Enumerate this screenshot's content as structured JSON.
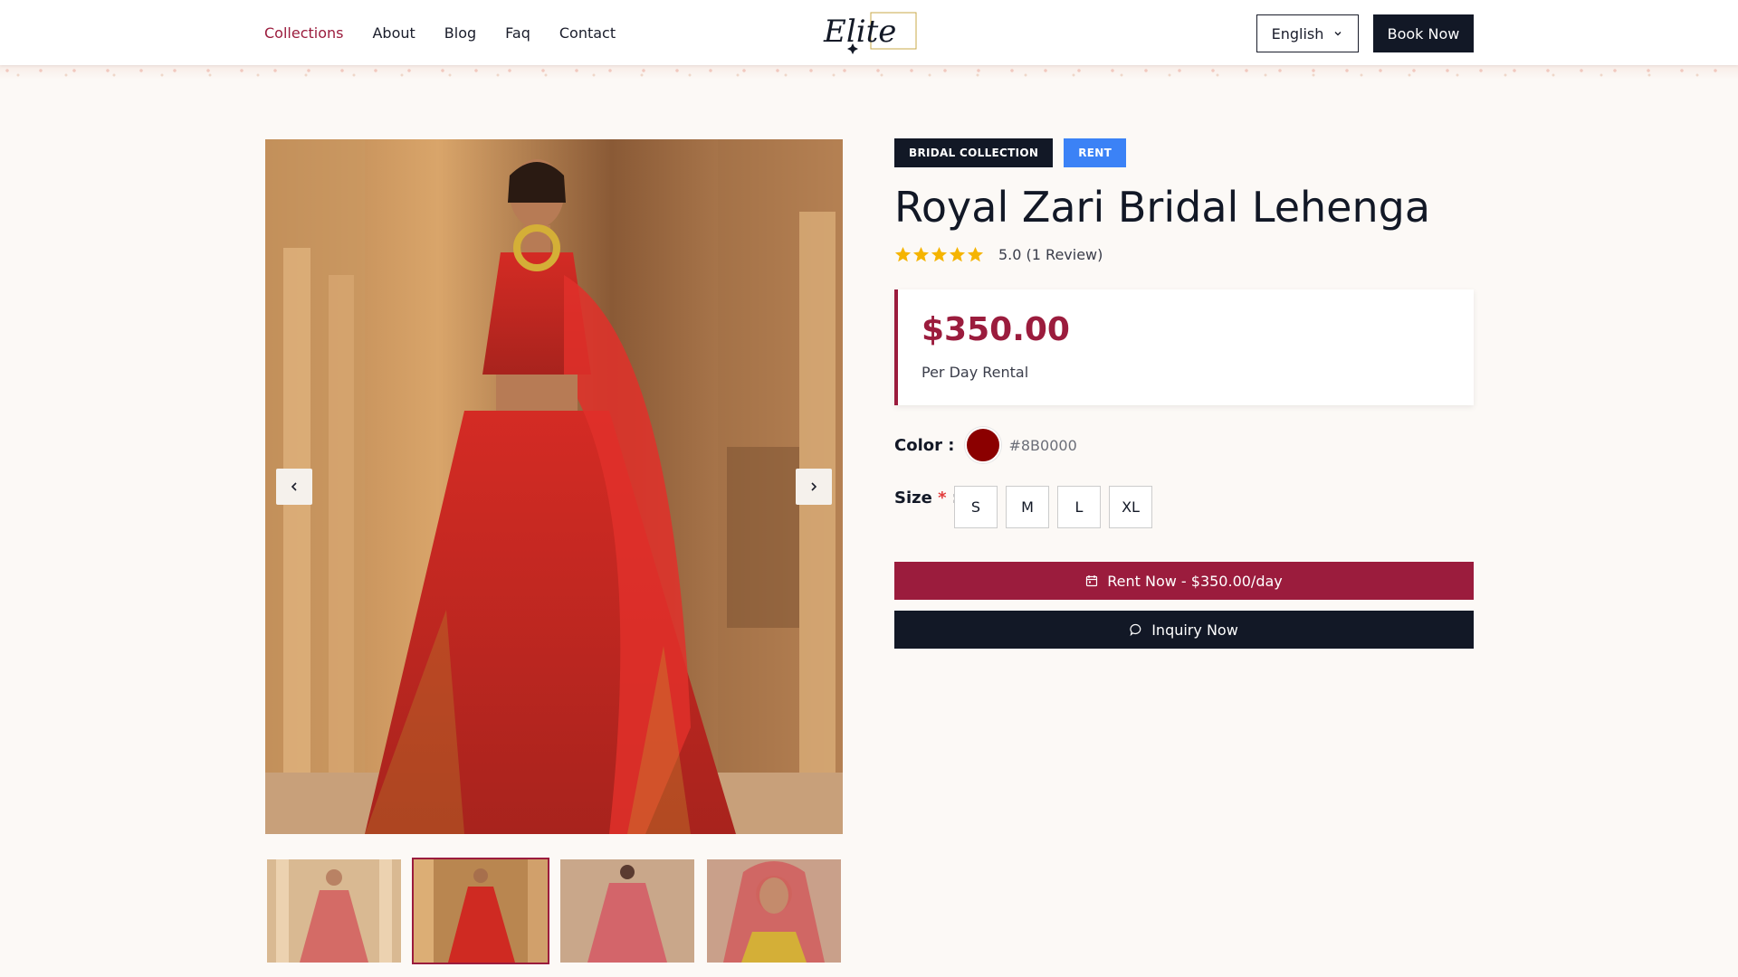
{
  "header": {
    "nav": [
      {
        "label": "Collections",
        "active": true
      },
      {
        "label": "About",
        "active": false
      },
      {
        "label": "Blog",
        "active": false
      },
      {
        "label": "Faq",
        "active": false
      },
      {
        "label": "Contact",
        "active": false
      }
    ],
    "logo_text": "Elite",
    "language": "English",
    "book_label": "Book Now"
  },
  "product": {
    "tags": [
      {
        "label": "BRIDAL COLLECTION",
        "color": "#121826"
      },
      {
        "label": "RENT",
        "color": "#3b82f6"
      }
    ],
    "title": "Royal Zari Bridal Lehenga",
    "rating": 5,
    "rating_text": "5.0 (1 Review)",
    "price": "$350.00",
    "price_sub": "Per Day Rental",
    "color_label": "Color :",
    "color_hex": "#8B0000",
    "size_label": "Size",
    "sizes": [
      "S",
      "M",
      "L",
      "XL"
    ],
    "rent_label": "Rent Now - $350.00/day",
    "inquiry_label": "Inquiry Now"
  },
  "gallery": {
    "selected_index": 1,
    "thumb_count": 4
  },
  "colors": {
    "accent": "#9b1c3d",
    "dark": "#121826",
    "star": "#f5b400"
  }
}
